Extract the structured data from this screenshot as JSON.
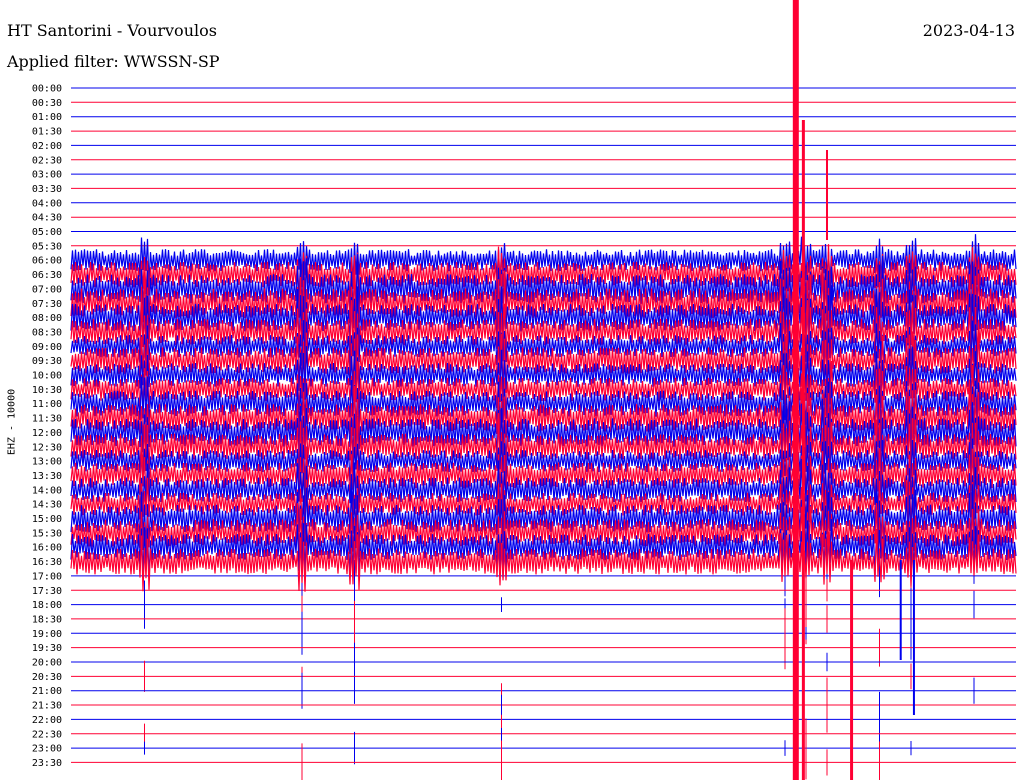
{
  "header": {
    "station": "HT Santorini - Vourvoulos",
    "date": "2023-04-13",
    "filter": "Applied filter: WWSSN-SP"
  },
  "chart_data": {
    "type": "line",
    "title": "HT Santorini - Vourvoulos",
    "subtitle": "Applied filter: WWSSN-SP",
    "ylabel": "EHZ - 10000",
    "grid": true,
    "colors": {
      "even_row": "#0000ee",
      "odd_row": "#ff0033",
      "background": "#ffffff"
    },
    "rows": [
      "00:00",
      "00:30",
      "01:00",
      "01:30",
      "02:00",
      "02:30",
      "03:00",
      "03:30",
      "04:00",
      "04:30",
      "05:00",
      "05:30",
      "06:00",
      "06:30",
      "07:00",
      "07:30",
      "08:00",
      "08:30",
      "09:00",
      "09:30",
      "10:00",
      "10:30",
      "11:00",
      "11:30",
      "12:00",
      "12:30",
      "13:00",
      "13:30",
      "14:00",
      "14:30",
      "15:00",
      "15:30",
      "16:00",
      "16:30",
      "17:00",
      "17:30",
      "18:00",
      "18:30",
      "19:00",
      "19:30",
      "20:00",
      "20:30",
      "21:00",
      "21:30",
      "22:00",
      "22:30",
      "23:00",
      "23:30"
    ],
    "noisy_rows": [
      "06:00",
      "06:30",
      "07:00",
      "07:30",
      "08:00",
      "08:30",
      "09:00",
      "09:30",
      "10:00",
      "10:30",
      "11:00",
      "11:30",
      "12:00",
      "12:30",
      "13:00",
      "13:30",
      "14:00",
      "14:30",
      "15:00",
      "15:30",
      "16:00",
      "16:30"
    ],
    "events_minutes": [
      7,
      22,
      27,
      41,
      68,
      70,
      72,
      77,
      80,
      86
    ]
  }
}
